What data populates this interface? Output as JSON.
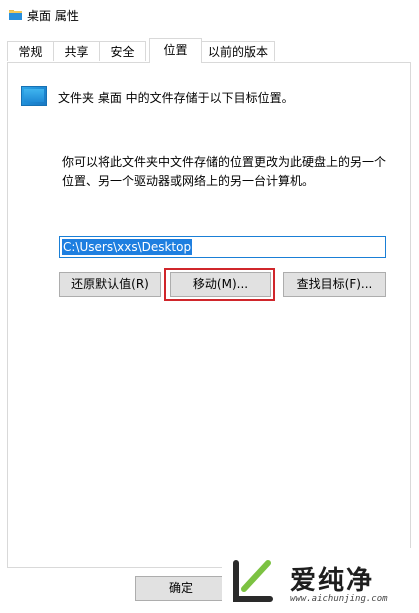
{
  "window": {
    "title": "桌面 属性",
    "icon": "folder-icon"
  },
  "tabs": [
    {
      "label": "常规",
      "active": false
    },
    {
      "label": "共享",
      "active": false
    },
    {
      "label": "安全",
      "active": false
    },
    {
      "label": "位置",
      "active": true
    },
    {
      "label": "以前的版本",
      "active": false
    }
  ],
  "location": {
    "intro": "文件夹 桌面 中的文件存储于以下目标位置。",
    "explain_line1": "你可以将此文件夹中文件存储的位置更改为此硬盘上的另一个",
    "explain_line2": "位置、另一个驱动器或网络上的另一台计算机。",
    "path_value": "C:\\Users\\xxs\\Desktop"
  },
  "buttons": {
    "restore_default": "还原默认值(R)",
    "move": "移动(M)...",
    "find_target": "查找目标(F)...",
    "ok": "确定"
  },
  "watermark": {
    "brand": "爱纯净",
    "url": "www.aichunjing.com"
  },
  "colors": {
    "highlight": "#d0262b",
    "selection": "#1e7fe0",
    "accent": "#1a7fd6"
  }
}
